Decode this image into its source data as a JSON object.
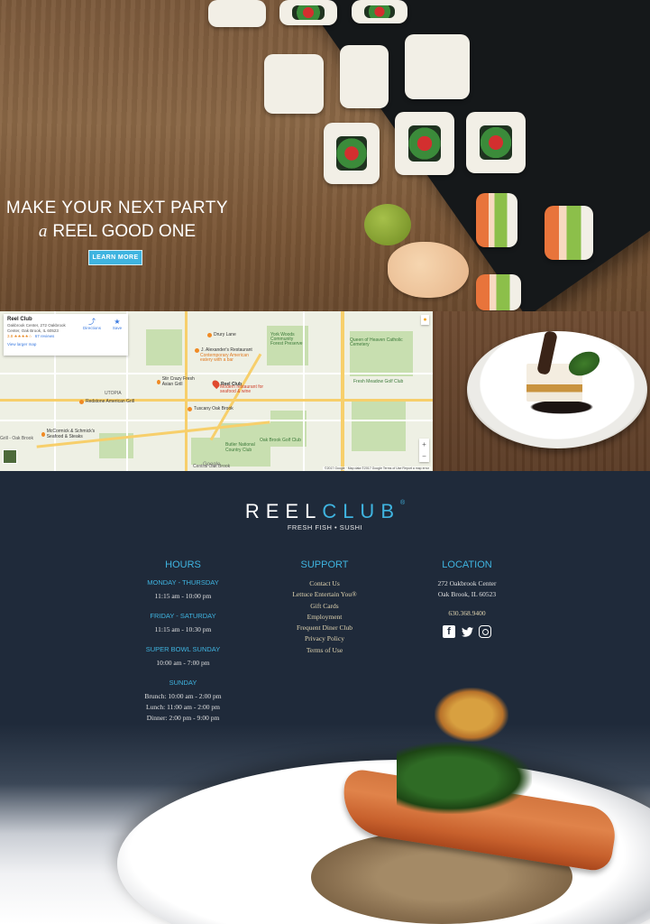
{
  "hero": {
    "headline_line1": "MAKE YOUR NEXT PARTY",
    "headline_a": "a",
    "headline_line2": "REEL GOOD ONE",
    "button_label": "LEARN MORE"
  },
  "map": {
    "place_name": "Reel Club",
    "address": "Oakbrook Center, 272 Oakbrook Center, Oak Brook, IL 60523",
    "rating": "3.8 ★★★★☆",
    "reviews": "67 reviews",
    "view_larger": "View larger map",
    "directions_label": "Directions",
    "save_label": "Save",
    "labels": {
      "drury_lane": "Drury Lane",
      "j_alexanders": "J. Alexander's Restaurant",
      "j_alexanders_sub": "Contemporary American eatery with a bar",
      "york_woods": "York Woods Community Forest Preserve",
      "queen_heaven": "Queen of Heaven Catholic Cemetery",
      "reel_club_pin": "Reel Club",
      "reel_club_pin_sub": "Modern restaurant for seafood & wine",
      "stir_crazy": "Stir Crazy Fresh Asian Grill",
      "redstone": "Redstone American Grill",
      "tuscany": "Tuscany Oak Brook",
      "mccormick": "McCormick & Schmick's Seafood & Steaks",
      "fresh_meadow": "Fresh Meadow Golf Club",
      "butler": "Butler National Country Club",
      "oak_brook_golf": "Oak Brook Golf Club",
      "utopia": "UTOPIA",
      "grill_oak_brook": "Grill - Oak Brook",
      "central_oak_brook": "Central Oak Brook"
    },
    "google_wordmark": "Google",
    "attribution": "©2017 Google · Map data ©2017 Google  Terms of Use  Report a map error",
    "zoom_in": "+",
    "zoom_out": "−"
  },
  "brand": {
    "logo_reel": "REEL",
    "logo_club": "CLUB",
    "logo_reg": "®",
    "tagline": "FRESH FISH • SUSHI"
  },
  "hours": {
    "heading": "HOURS",
    "groups": [
      {
        "day": "MONDAY - THURSDAY",
        "times": [
          "11:15 am - 10:00 pm"
        ]
      },
      {
        "day": "FRIDAY - SATURDAY",
        "times": [
          "11:15 am - 10:30 pm"
        ]
      },
      {
        "day": "SUPER BOWL SUNDAY",
        "times": [
          "10:00 am - 7:00 pm"
        ]
      },
      {
        "day": "SUNDAY",
        "times": [
          "Brunch: 10:00 am - 2:00 pm",
          "Lunch: 11:00 am - 2:00 pm",
          "Dinner: 2:00 pm - 9:00 pm"
        ]
      }
    ]
  },
  "support": {
    "heading": "SUPPORT",
    "links": [
      "Contact Us",
      "Lettuce Entertain You®",
      "Gift Cards",
      "Employment",
      "Frequent Diner Club",
      "Privacy Policy",
      "Terms of Use"
    ]
  },
  "location": {
    "heading": "LOCATION",
    "address_line1": "272 Oakbrook Center",
    "address_line2": "Oak Brook, IL 60523",
    "phone": "630.368.9400",
    "social": [
      {
        "name": "facebook-icon",
        "glyph": "f"
      },
      {
        "name": "twitter-icon",
        "glyph": "🐦"
      },
      {
        "name": "instagram-icon",
        "glyph": ""
      }
    ]
  },
  "colors": {
    "accent": "#3fb4e0",
    "footer_bg": "#1f2a3a",
    "link": "#e0d4b0"
  }
}
